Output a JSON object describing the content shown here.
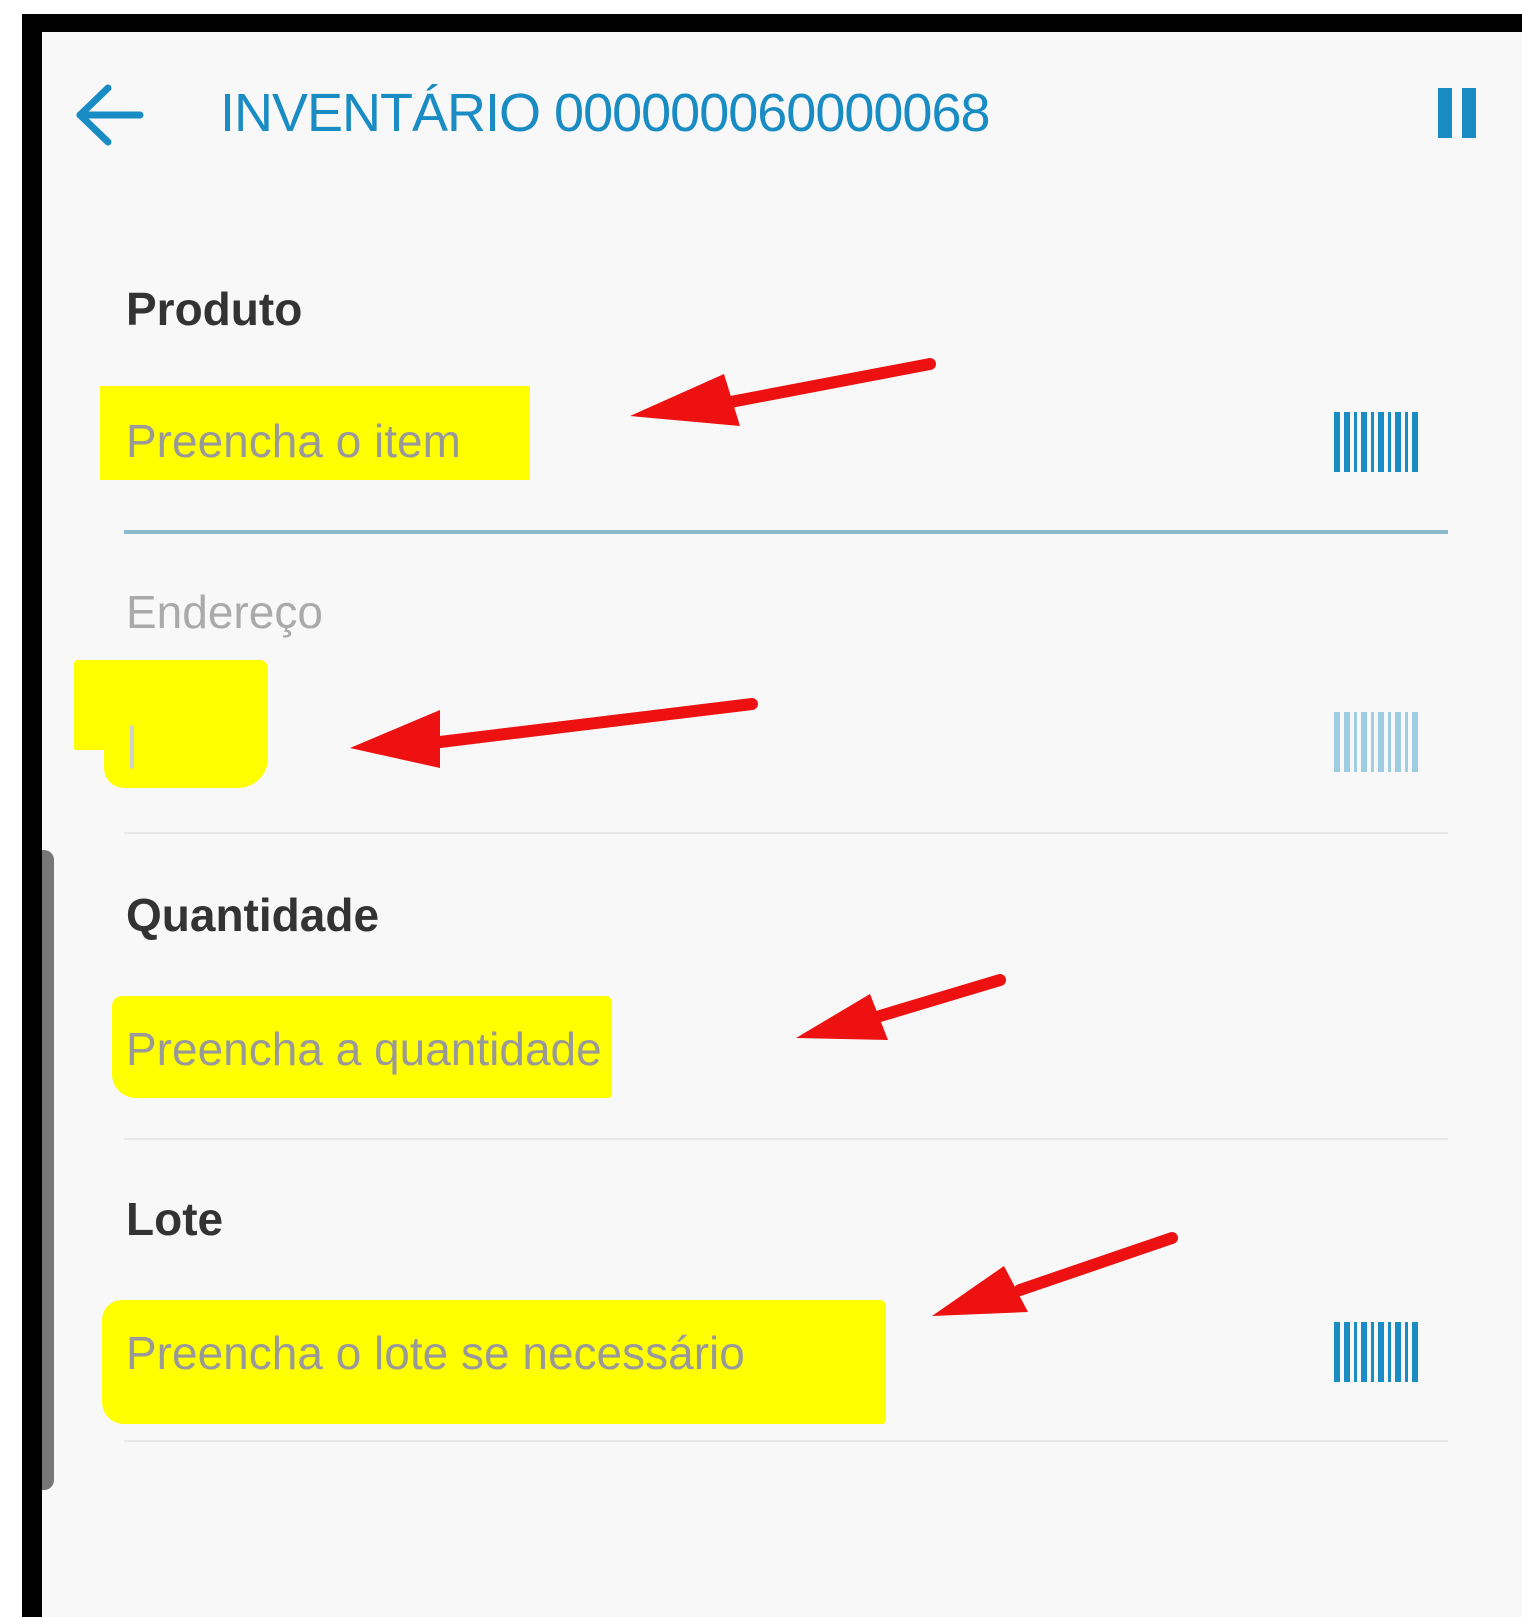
{
  "header": {
    "back_icon": "arrow-left-icon",
    "title": "INVENTÁRIO 000000060000068",
    "pause_icon": "pause-icon",
    "accent_color": "#1a8cc4"
  },
  "form": {
    "produto": {
      "label": "Produto",
      "placeholder": "Preencha o item",
      "icon": "barcode-icon"
    },
    "endereco": {
      "label": "Endereço",
      "value": "|",
      "icon": "barcode-icon"
    },
    "quantidade": {
      "label": "Quantidade",
      "placeholder": "Preencha a quantidade"
    },
    "lote": {
      "label": "Lote",
      "placeholder": "Preencha o lote se necessário",
      "icon": "barcode-icon"
    }
  },
  "annotations": {
    "highlight_color": "#ffff00",
    "arrow_color": "#ee1111"
  }
}
